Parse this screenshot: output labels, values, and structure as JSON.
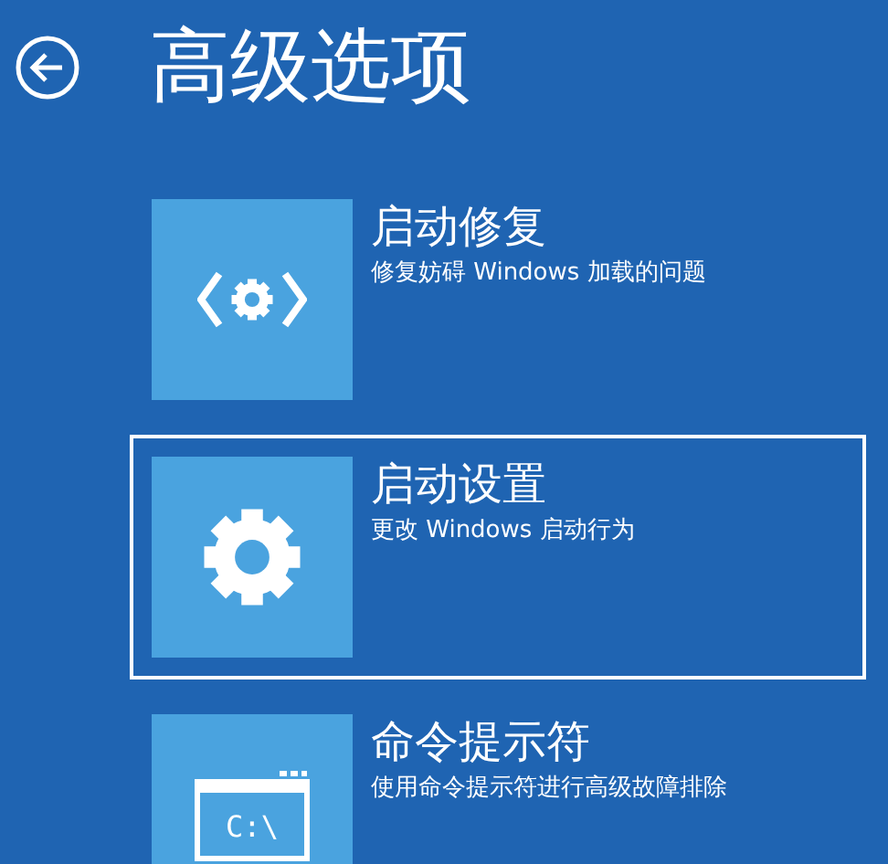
{
  "title": "高级选项",
  "options": [
    {
      "kind": "repair",
      "label": "启动修复",
      "description": "修复妨碍 Windows 加载的问题",
      "selected": false
    },
    {
      "kind": "settings",
      "label": "启动设置",
      "description": "更改 Windows 启动行为",
      "selected": true
    },
    {
      "kind": "cmd",
      "label": "命令提示符",
      "description": "使用命令提示符进行高级故障排除",
      "selected": false,
      "icon_text": "C:\\"
    }
  ]
}
